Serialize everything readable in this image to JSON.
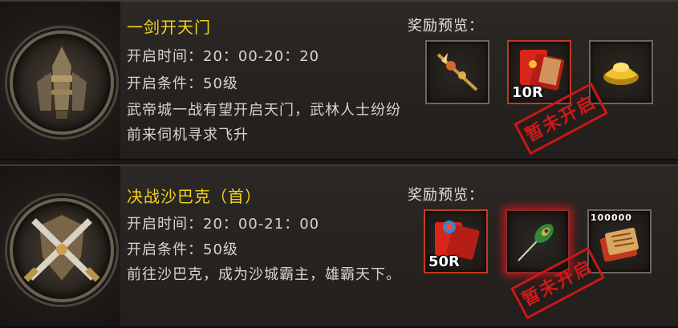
{
  "events": [
    {
      "title": "一剑开天门",
      "time": "开启时间：20：00-20：20",
      "condition": "开启条件：50级",
      "description": "武帝城一战有望开启天门，武林人士纷纷前来伺机寻求飞升",
      "reward_label": "奖励预览：",
      "emblem": "tower-emblem-icon",
      "rewards": [
        {
          "icon": "golden-staff-icon",
          "quantity": ""
        },
        {
          "icon": "red-envelope-icon",
          "quantity": "10R"
        },
        {
          "icon": "gold-ingot-icon",
          "quantity": ""
        }
      ],
      "stamp": "暂未开启"
    },
    {
      "title": "决战沙巴克（首）",
      "time": "开启时间：20：00-21：00",
      "condition": "开启条件：50级",
      "description": "前往沙巴克，成为沙城霸主，雄霸天下。",
      "reward_label": "奖励预览：",
      "emblem": "crossed-swords-emblem-icon",
      "rewards": [
        {
          "icon": "red-envelope-gem-icon",
          "quantity": "50R"
        },
        {
          "icon": "peacock-feather-icon",
          "quantity": ""
        },
        {
          "icon": "scroll-bundle-icon",
          "quantity": "100000"
        }
      ],
      "stamp": "暂未开启"
    }
  ],
  "colors": {
    "title": "#f4d21a",
    "text": "#d9d4cb",
    "stamp": "#d21818"
  }
}
